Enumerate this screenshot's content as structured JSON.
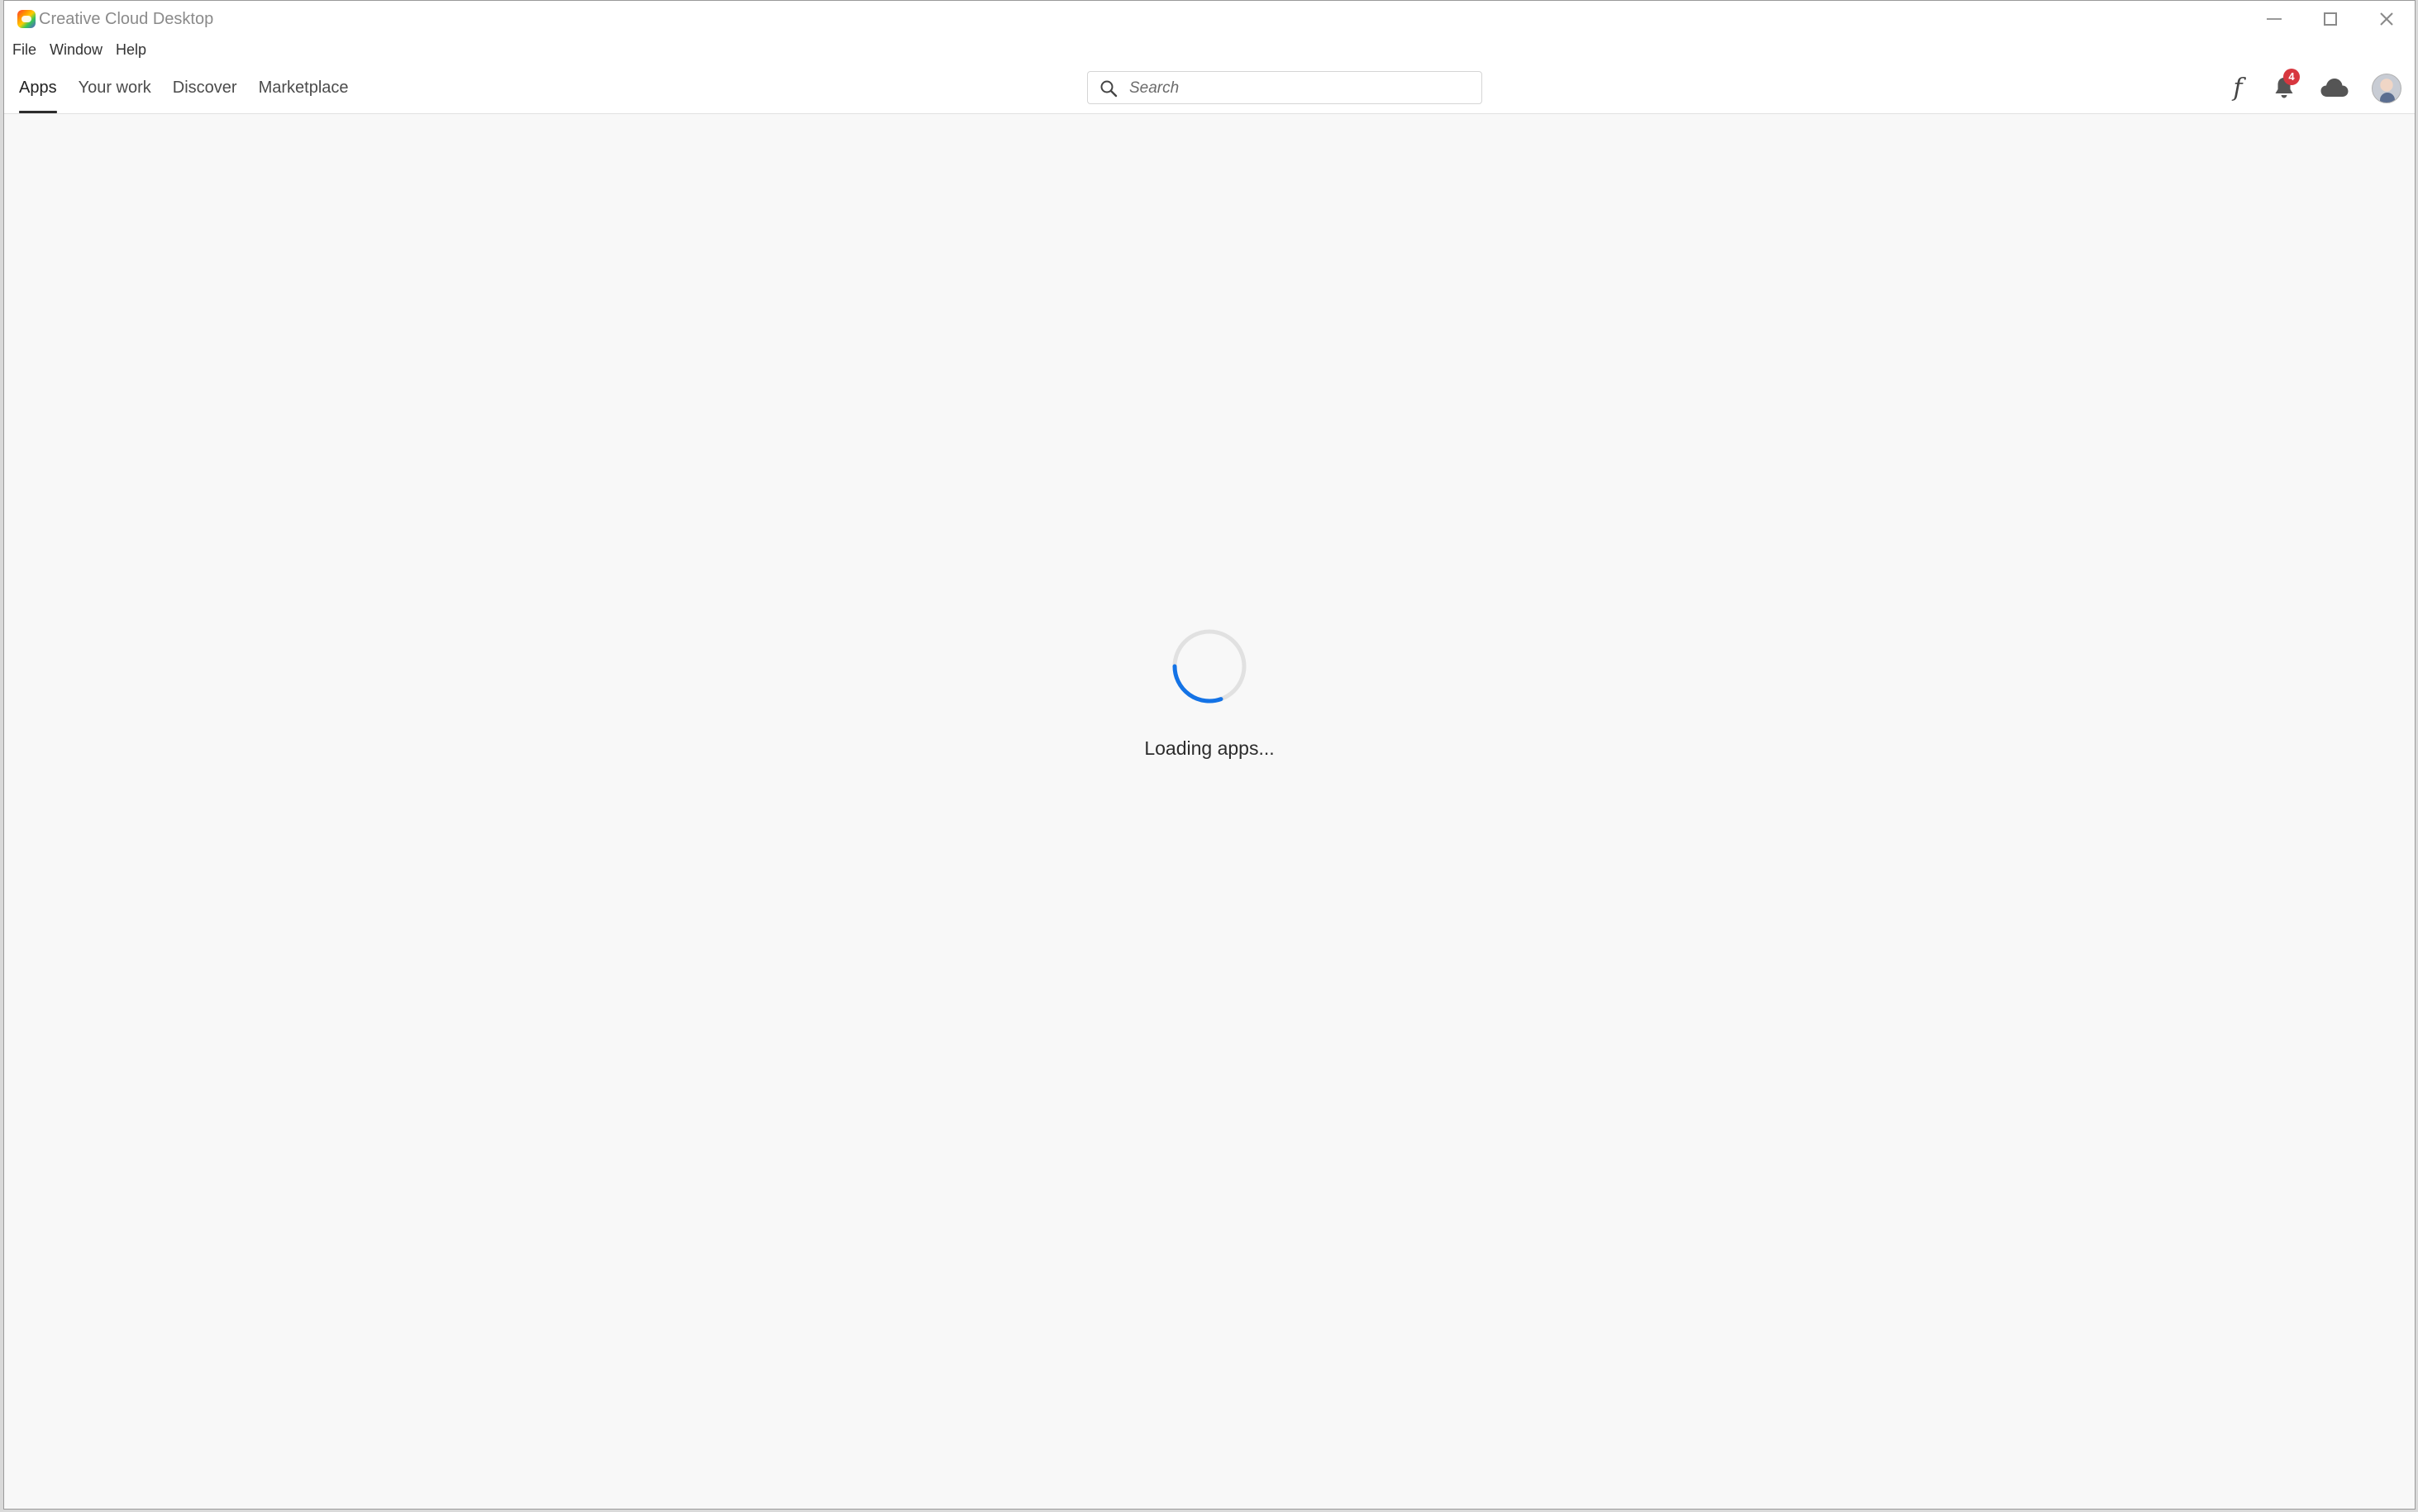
{
  "window": {
    "title": "Creative Cloud Desktop"
  },
  "menu": {
    "items": [
      {
        "label": "File"
      },
      {
        "label": "Window"
      },
      {
        "label": "Help"
      }
    ]
  },
  "nav": {
    "tabs": [
      {
        "label": "Apps",
        "active": true
      },
      {
        "label": "Your work",
        "active": false
      },
      {
        "label": "Discover",
        "active": false
      },
      {
        "label": "Marketplace",
        "active": false
      }
    ]
  },
  "search": {
    "placeholder": "Search",
    "value": ""
  },
  "header_icons": {
    "fonts_glyph": "f",
    "notifications_count": "4",
    "icons": [
      "fonts-icon",
      "bell-icon",
      "cloud-icon",
      "avatar"
    ]
  },
  "main": {
    "loading_text": "Loading apps..."
  },
  "colors": {
    "spinner_accent": "#1473e6",
    "spinner_track": "#e1e1e1",
    "badge": "#d7373f",
    "background": "#f8f8f8"
  }
}
